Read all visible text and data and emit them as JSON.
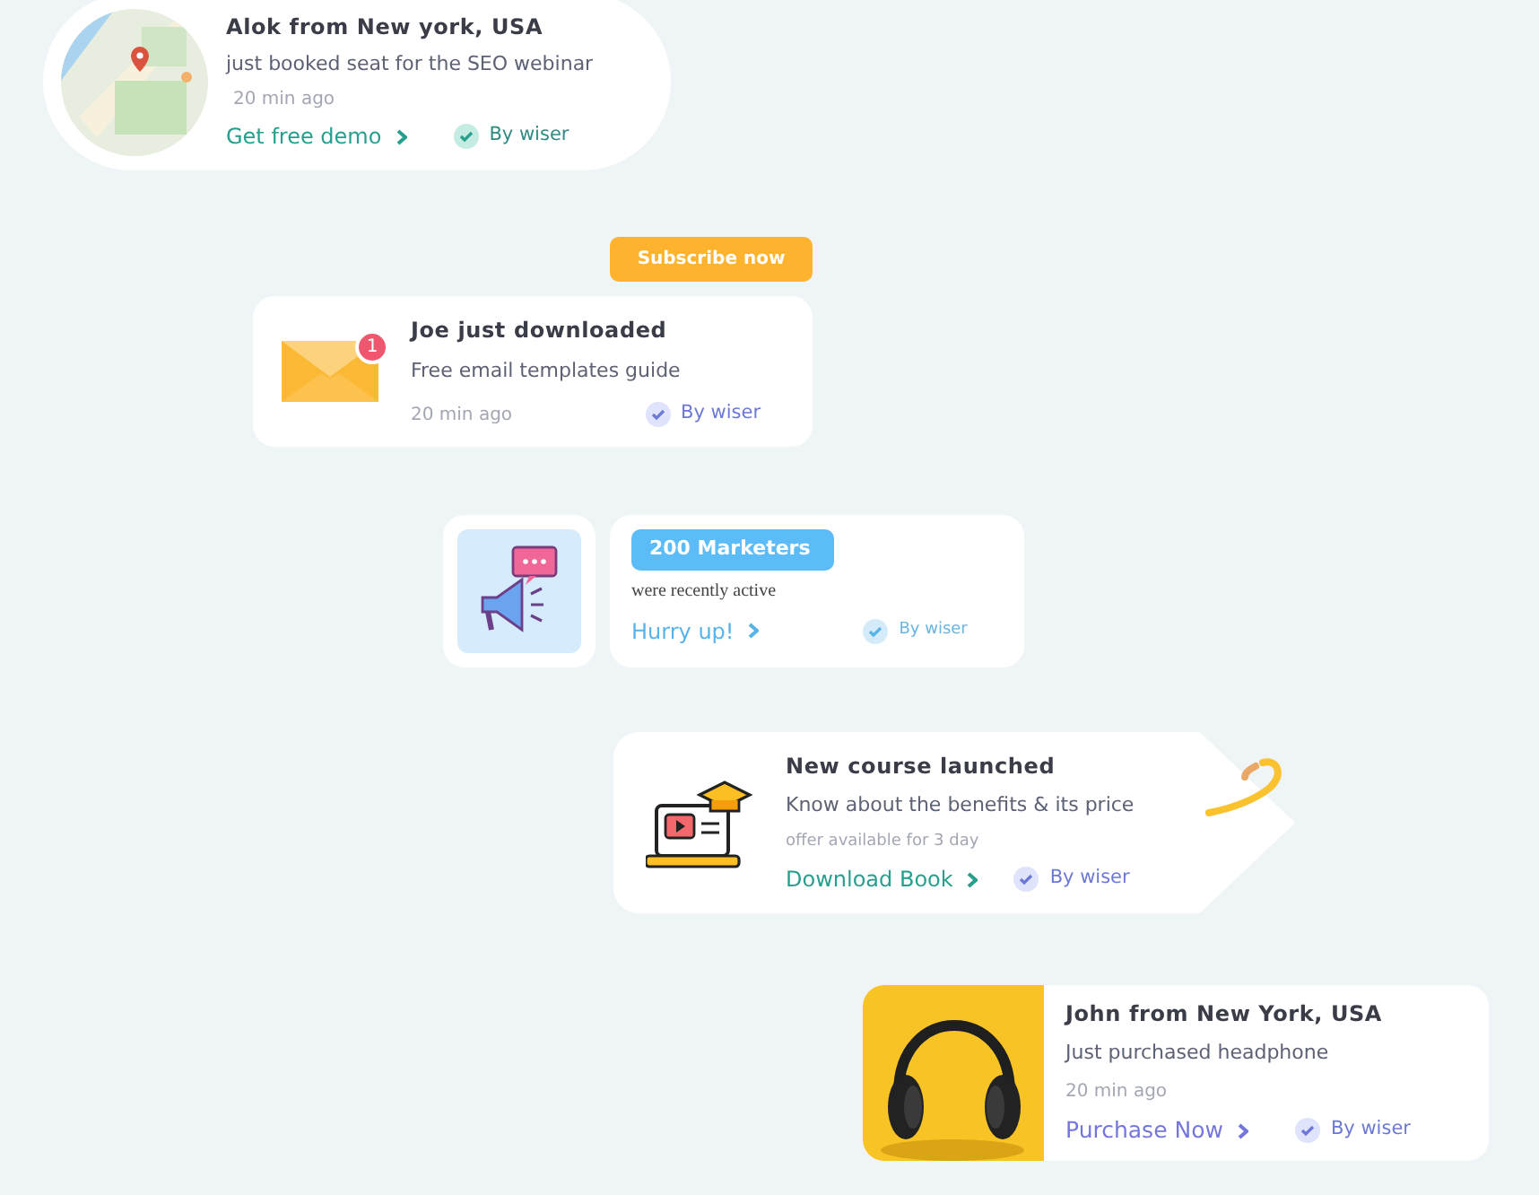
{
  "notifications": [
    {
      "kind": "map",
      "title": "Alok from New york, USA",
      "subtitle": "just booked seat for the SEO webinar",
      "time": "20 min ago",
      "cta": "Get free demo",
      "verified": "By wiser"
    },
    {
      "kind": "email",
      "button": "Subscribe now",
      "count": "1",
      "title": "Joe just downloaded",
      "subtitle": "Free email templates guide",
      "time": "20 min ago",
      "verified": "By wiser"
    },
    {
      "kind": "marketers",
      "title": "200 Marketers",
      "subtitle": "were recently active",
      "cta": "Hurry up!",
      "verified": "By wiser"
    },
    {
      "kind": "course",
      "title": "New course launched",
      "subtitle": "Know about the benefits & its price",
      "time": "offer available for 3 day",
      "cta": "Download Book",
      "verified": "By wiser"
    },
    {
      "kind": "product",
      "title": "John from New York, USA",
      "subtitle": "Just purchased headphone",
      "time": "20 min ago",
      "cta": "Purchase Now",
      "verified": "By wiser"
    }
  ]
}
